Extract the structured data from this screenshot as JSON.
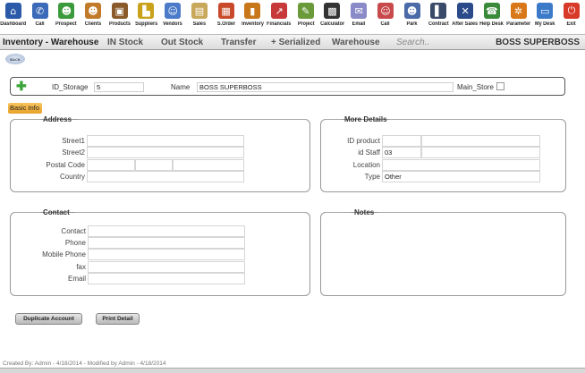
{
  "toolbar": [
    {
      "label": "Dashboard",
      "icon": "home-icon",
      "glyph": "⌂",
      "color": "#2a5aa8"
    },
    {
      "label": "Call",
      "icon": "phone-icon",
      "glyph": "✆",
      "color": "#3a6ab8"
    },
    {
      "label": "Prospect",
      "icon": "people-icon",
      "glyph": "☻",
      "color": "#3b9a3b"
    },
    {
      "label": "Clients",
      "icon": "people-icon",
      "glyph": "☻",
      "color": "#c07a2a"
    },
    {
      "label": "Products",
      "icon": "box-icon",
      "glyph": "▣",
      "color": "#8a5a2a"
    },
    {
      "label": "Suppliers",
      "icon": "boot-icon",
      "glyph": "▙",
      "color": "#c9a21a"
    },
    {
      "label": "Vendors",
      "icon": "person-icon",
      "glyph": "☺",
      "color": "#4a7ac8"
    },
    {
      "label": "Sales",
      "icon": "document-icon",
      "glyph": "▤",
      "color": "#c8a85a"
    },
    {
      "label": "S.Order",
      "icon": "order-icon",
      "glyph": "▦",
      "color": "#c84a2a"
    },
    {
      "label": "Inventory",
      "icon": "inventory-icon",
      "glyph": "▮",
      "color": "#c8781a"
    },
    {
      "label": "Financials",
      "icon": "chart-icon",
      "glyph": "↗",
      "color": "#c83a3a"
    },
    {
      "label": "Project",
      "icon": "pencil-icon",
      "glyph": "✎",
      "color": "#6a9a3a"
    },
    {
      "label": "Calculator",
      "icon": "calculator-icon",
      "glyph": "▩",
      "color": "#333333"
    },
    {
      "label": "Email",
      "icon": "email-icon",
      "glyph": "✉",
      "color": "#8a8ac8"
    },
    {
      "label": "Call",
      "icon": "person-icon",
      "glyph": "☺",
      "color": "#c84a4a"
    },
    {
      "label": "Park",
      "icon": "people-icon",
      "glyph": "☻",
      "color": "#4a6aa8"
    },
    {
      "label": "Contract",
      "icon": "contract-icon",
      "glyph": "▌",
      "color": "#3a4a6a"
    },
    {
      "label": "After Sales",
      "icon": "tools-icon",
      "glyph": "✕",
      "color": "#2a4a8a"
    },
    {
      "label": "Help Desk",
      "icon": "help-icon",
      "glyph": "☎",
      "color": "#3a8a3a"
    },
    {
      "label": "Parameter",
      "icon": "gears-icon",
      "glyph": "✲",
      "color": "#d8781a"
    },
    {
      "label": "My Desk",
      "icon": "monitor-icon",
      "glyph": "▭",
      "color": "#3a7ac8"
    },
    {
      "label": "Exit",
      "icon": "power-icon",
      "glyph": "⏻",
      "color": "#d83a2a"
    }
  ],
  "nav": {
    "title": "Inventory - Warehouse",
    "tabs": [
      "IN Stock",
      "Out Stock",
      "Transfer",
      "+ Serialized",
      "Warehouse"
    ],
    "search_placeholder": "Search..",
    "company": "BOSS SUPERBOSS"
  },
  "back_label": "BACK",
  "idbar": {
    "id_label": "ID_Storage",
    "id_value": "5",
    "name_label": "Name",
    "name_value": "BOSS SUPERBOSS",
    "main_store_label": "Main_Store"
  },
  "basic_info_tab": "Basic Info",
  "address": {
    "title": "Address",
    "fields": [
      "Street1",
      "Street2",
      "Postal Code",
      "Country"
    ]
  },
  "more_details": {
    "title": "More Details",
    "fields": [
      "ID product",
      "id Staff",
      "Location",
      "Type"
    ],
    "staff_value": "03",
    "type_value": "Other"
  },
  "contact": {
    "title": "Contact",
    "fields": [
      "Contact",
      "Phone",
      "Mobile Phone",
      "fax",
      "Email"
    ]
  },
  "notes": {
    "title": "Notes"
  },
  "buttons": {
    "duplicate": "Duplicate Account",
    "print": "Print Detail"
  },
  "footer": "Created By: Admin - 4/18/2014 - Modified by Admin - 4/18/2014"
}
